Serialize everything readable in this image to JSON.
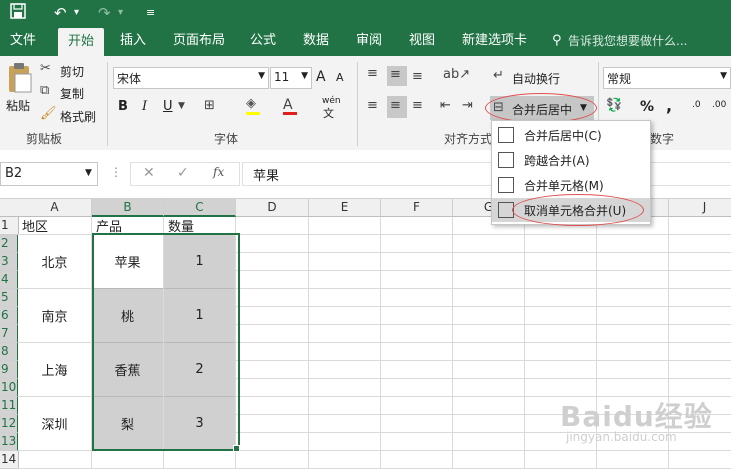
{
  "colors": {
    "brand": "#217346",
    "ribbon_bg": "#f3f3f3",
    "merged_fill": "#d0d0d0",
    "highlight_oval": "#e05050"
  },
  "quick_access": {
    "save_icon": "save-icon",
    "undo_icon": "undo-icon",
    "redo_icon": "redo-icon",
    "customize_icon": "customize-icon"
  },
  "tabs": [
    {
      "label": "文件",
      "active": false
    },
    {
      "label": "开始",
      "active": true
    },
    {
      "label": "插入",
      "active": false
    },
    {
      "label": "页面布局",
      "active": false
    },
    {
      "label": "公式",
      "active": false
    },
    {
      "label": "数据",
      "active": false
    },
    {
      "label": "审阅",
      "active": false
    },
    {
      "label": "视图",
      "active": false
    },
    {
      "label": "新建选项卡",
      "active": false
    }
  ],
  "tell_me": "告诉我您想要做什么...",
  "clipboard": {
    "paste": "粘贴",
    "cut": "剪切",
    "copy": "复制",
    "format_painter": "格式刷",
    "group": "剪贴板"
  },
  "font": {
    "name": "宋体",
    "size": "11",
    "grow": "A",
    "shrink": "A",
    "bold": "B",
    "italic": "I",
    "underline": "U",
    "phonetic_top": "wén",
    "phonetic_bottom": "文",
    "group": "字体"
  },
  "alignment": {
    "wrap_text": "自动换行",
    "merge_center": "合并后居中",
    "group": "对齐方式"
  },
  "number": {
    "format": "常规",
    "percent": "%",
    "comma": ",",
    "inc_dec": ".0",
    "dec_dec": ".00",
    "group": "数字"
  },
  "merge_menu": [
    {
      "label": "合并后居中(C)",
      "highlighted": false
    },
    {
      "label": "跨越合并(A)",
      "highlighted": false
    },
    {
      "label": "合并单元格(M)",
      "highlighted": false
    },
    {
      "label": "取消单元格合并(U)",
      "highlighted": true
    }
  ],
  "formula_bar": {
    "name_box": "B2",
    "cancel": "✕",
    "enter": "✓",
    "fx": "fx",
    "content": "苹果"
  },
  "columns": [
    "A",
    "B",
    "C",
    "D",
    "E",
    "F",
    "G",
    "H",
    "I",
    "J"
  ],
  "rows": [
    "1",
    "2",
    "3",
    "4",
    "5",
    "6",
    "7",
    "8",
    "9",
    "10",
    "11",
    "12",
    "13",
    "14"
  ],
  "headers": {
    "a1": "地区",
    "b1": "产品",
    "c1": "数量"
  },
  "data_rows": [
    {
      "region": "北京",
      "product": "苹果",
      "qty": "1"
    },
    {
      "region": "南京",
      "product": "桃",
      "qty": "1"
    },
    {
      "region": "上海",
      "product": "香蕉",
      "qty": "2"
    },
    {
      "region": "深圳",
      "product": "梨",
      "qty": "3"
    }
  ],
  "watermark": {
    "text": "Baidu经验",
    "url": "jingyan.baidu.com"
  }
}
